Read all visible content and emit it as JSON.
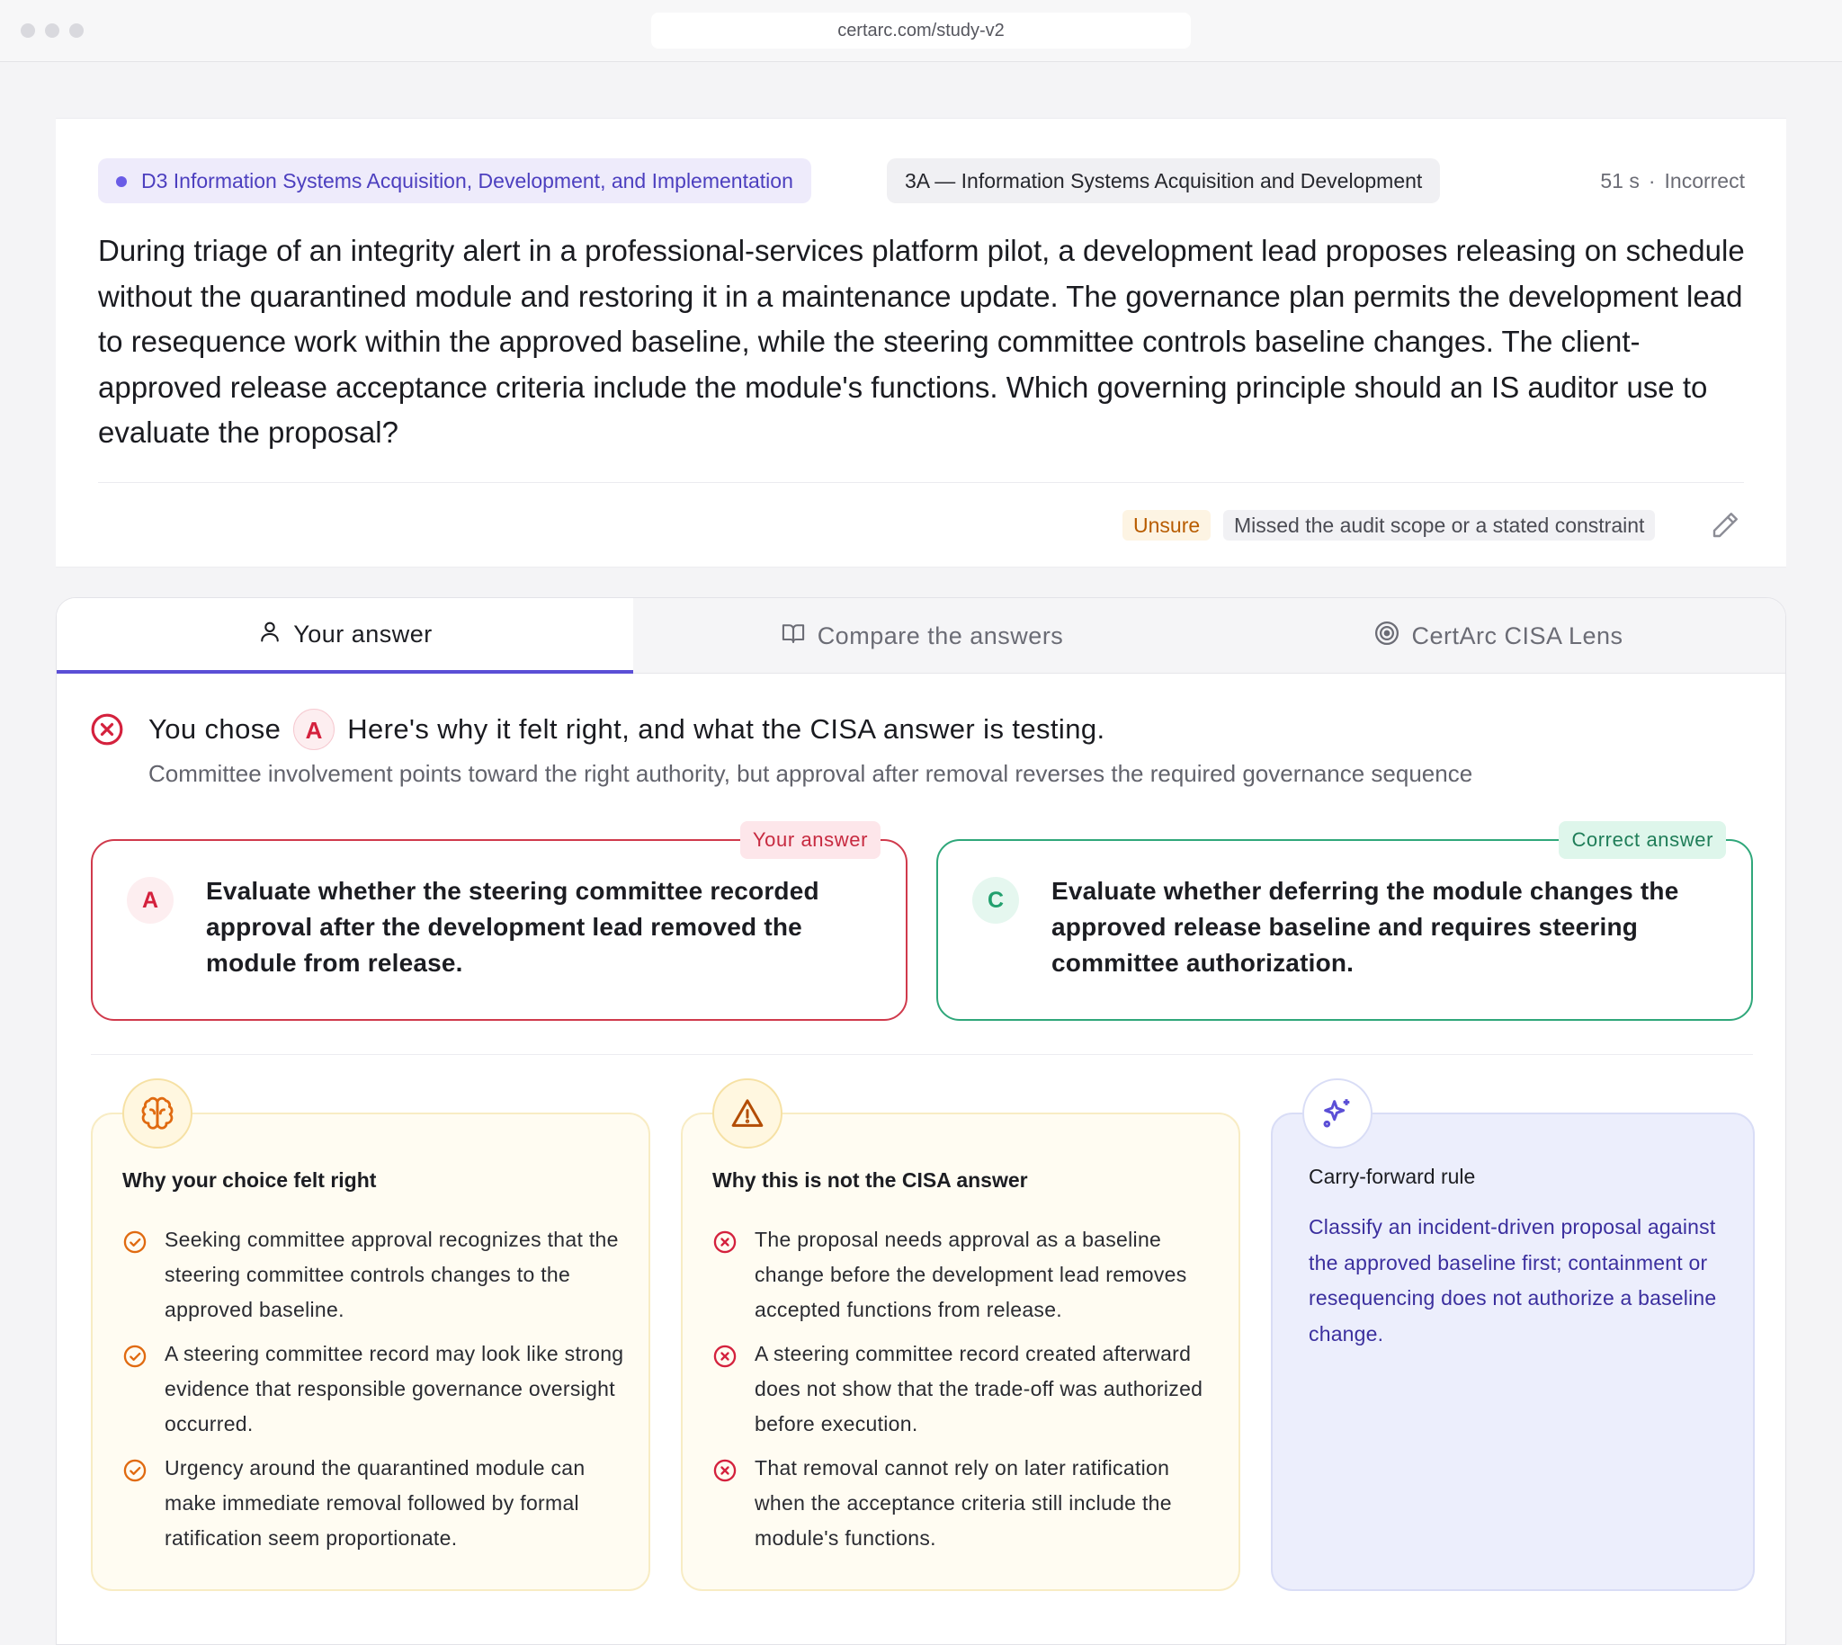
{
  "browser": {
    "url": "certarc.com/study-v2"
  },
  "question": {
    "domain_tag": "D3 Information Systems Acquisition, Development, and Implementation",
    "subdomain_tag": "3A — Information Systems Acquisition and Development",
    "time": "51 s",
    "separator": "·",
    "result": "Incorrect",
    "text": "During triage of an integrity alert in a professional-services platform pilot, a development lead proposes releasing on schedule without the quarantined module and restoring it in a maintenance update. The governance plan permits the development lead to resequence work within the approved baseline, while the steering committee controls baseline changes. The client-approved release acceptance criteria include the module's functions. Which governing principle should an IS auditor use to evaluate the proposal?",
    "confidence_chip": "Unsure",
    "reason_chip": "Missed the audit scope or a stated constraint"
  },
  "tabs": [
    {
      "label": "Your answer",
      "icon": "user-icon",
      "active": true
    },
    {
      "label": "Compare the answers",
      "icon": "book-open-icon",
      "active": false
    },
    {
      "label": "CertArc CISA Lens",
      "icon": "target-icon",
      "active": false
    }
  ],
  "result_header": {
    "prefix": "You chose",
    "letter": "A",
    "headline": "Here's why it felt right, and what the CISA answer is testing.",
    "subline": "Committee involvement points toward the right authority, but approval after removal reverses the required governance sequence"
  },
  "answers": {
    "chosen": {
      "label": "Your answer",
      "letter": "A",
      "text": "Evaluate whether the steering committee recorded approval after the development lead removed the module from release."
    },
    "correct": {
      "label": "Correct answer",
      "letter": "C",
      "text": "Evaluate whether deferring the module changes the approved release baseline and requires steering committee authorization."
    }
  },
  "explanations": {
    "felt_right": {
      "title": "Why your choice felt right",
      "icon": "brain-icon",
      "items": [
        "Seeking committee approval recognizes that the steering committee controls changes to the approved baseline.",
        "A steering committee record may look like strong evidence that responsible governance oversight occurred.",
        "Urgency around the quarantined module can make immediate removal followed by formal ratification seem proportionate."
      ]
    },
    "not_answer": {
      "title": "Why this is not the CISA answer",
      "icon": "warning-icon",
      "items": [
        "The proposal needs approval as a baseline change before the development lead removes accepted functions from release.",
        "A steering committee record created afterward does not show that the trade-off was authorized before execution.",
        "That removal cannot rely on later ratification when the acceptance criteria still include the module's functions."
      ]
    },
    "rule": {
      "title": "Carry-forward rule",
      "icon": "sparkles-icon",
      "text": "Classify an incident-driven proposal against the approved baseline first; containment or resequencing does not authorize a baseline change."
    }
  },
  "colors": {
    "accent": "#5b4fd6",
    "wrong": "#d03a4c",
    "correct": "#2fa77a",
    "warning": "#b85c00"
  }
}
